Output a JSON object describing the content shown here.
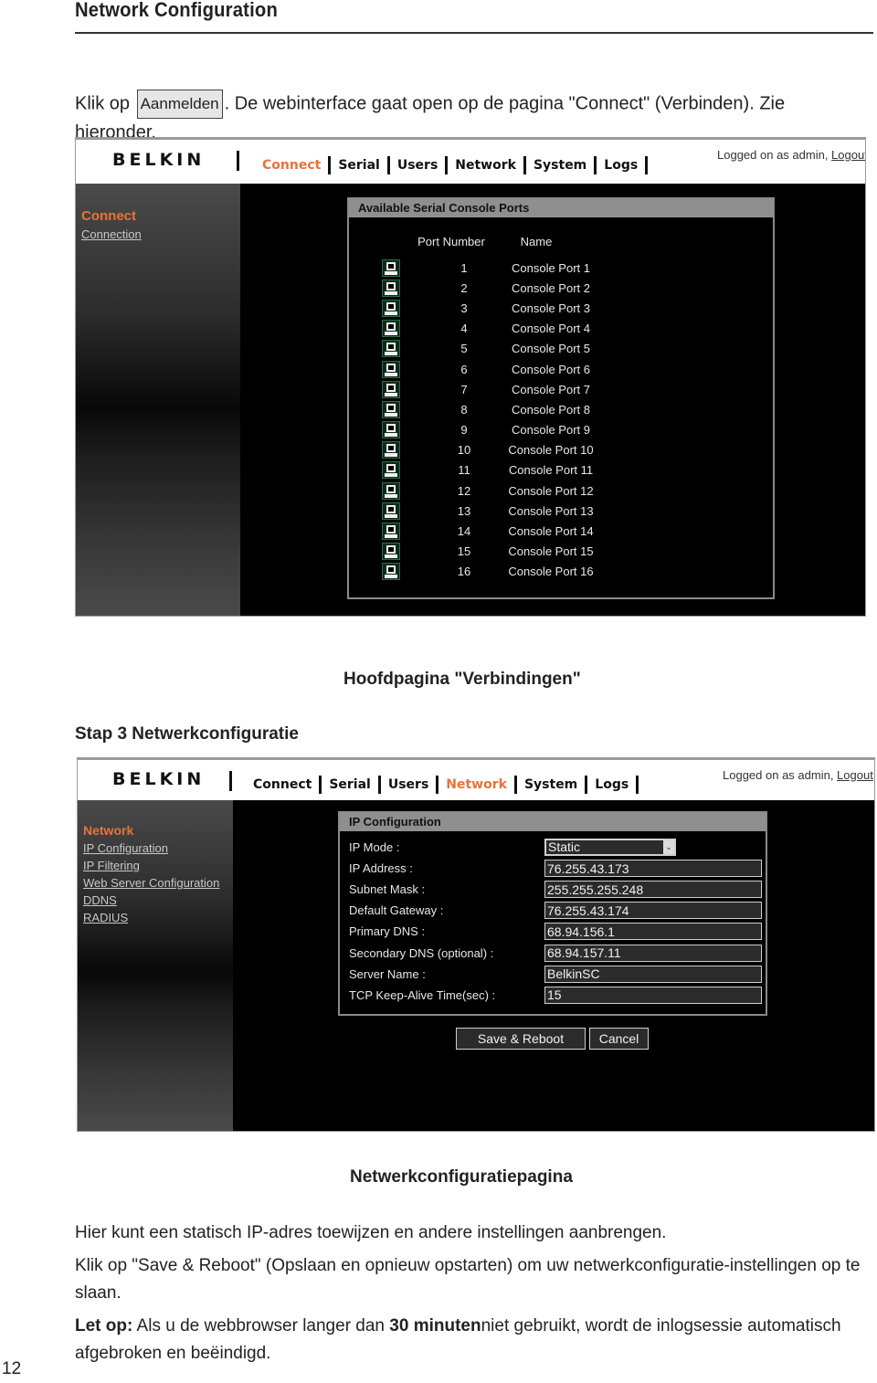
{
  "page": {
    "header": "Network Configuration",
    "page_number": "12",
    "intro_before": "Klik op ",
    "intro_button": "Aanmelden",
    "intro_after": ". De webinterface gaat open op de pagina \"Connect\" (Verbinden). Zie hieronder.",
    "caption1": "Hoofdpagina \"Verbindingen\"",
    "step_heading": "Stap 3 Netwerkconfiguratie",
    "caption2": "Netwerkconfiguratiepagina",
    "body1": "Hier kunt een statisch IP-adres toewijzen en andere instellingen aanbrengen.",
    "body2": "Klik op \"Save & Reboot\" (Opslaan en opnieuw opstarten) om uw netwerkconfiguratie-instellingen op te slaan.",
    "note_label": "Let op:",
    "note_text1": " Als u de webbrowser langer dan ",
    "note_bold": "30 minuten",
    "note_text2": "niet gebruikt, wordt de inlogsessie automatisch afgebroken en beëindigd."
  },
  "app": {
    "brand": "BELKIN",
    "accent_color": "#e8733a",
    "nav": [
      "Connect",
      "Serial",
      "Users",
      "Network",
      "System",
      "Logs"
    ],
    "logged_text": "Logged on as admin, ",
    "logout": "Logout"
  },
  "connect_page": {
    "active_nav": "Connect",
    "sidebar_title": "Connect",
    "sidebar_links": [
      "Connection"
    ],
    "panel_title": "Available Serial Console Ports",
    "col_port": "Port Number",
    "col_name": "Name",
    "port_icon": "computer-terminal-icon",
    "ports": [
      {
        "num": "1",
        "name": "Console Port 1"
      },
      {
        "num": "2",
        "name": "Console Port 2"
      },
      {
        "num": "3",
        "name": "Console Port 3"
      },
      {
        "num": "4",
        "name": "Console Port 4"
      },
      {
        "num": "5",
        "name": "Console Port 5"
      },
      {
        "num": "6",
        "name": "Console Port 6"
      },
      {
        "num": "7",
        "name": "Console Port 7"
      },
      {
        "num": "8",
        "name": "Console Port 8"
      },
      {
        "num": "9",
        "name": "Console Port 9"
      },
      {
        "num": "10",
        "name": "Console Port 10"
      },
      {
        "num": "11",
        "name": "Console Port 11"
      },
      {
        "num": "12",
        "name": "Console Port 12"
      },
      {
        "num": "13",
        "name": "Console Port 13"
      },
      {
        "num": "14",
        "name": "Console Port 14"
      },
      {
        "num": "15",
        "name": "Console Port 15"
      },
      {
        "num": "16",
        "name": "Console Port 16"
      }
    ]
  },
  "network_page": {
    "active_nav": "Network",
    "sidebar_title": "Network",
    "sidebar_links": [
      "IP Configuration",
      "IP Filtering",
      "Web Server Configuration",
      "DDNS",
      "RADIUS"
    ],
    "panel_title": "IP Configuration",
    "ip_mode_label": "IP Mode :",
    "ip_mode_value": "Static",
    "fields": [
      {
        "label": "IP Address :",
        "value": "76.255.43.173"
      },
      {
        "label": "Subnet Mask :",
        "value": "255.255.255.248"
      },
      {
        "label": "Default Gateway :",
        "value": "76.255.43.174"
      },
      {
        "label": "Primary DNS :",
        "value": "68.94.156.1"
      },
      {
        "label": "Secondary DNS (optional) :",
        "value": "68.94.157.11"
      },
      {
        "label": "Server Name :",
        "value": "BelkinSC"
      },
      {
        "label": "TCP Keep-Alive Time(sec) :",
        "value": "15"
      }
    ],
    "save_label": "Save & Reboot",
    "cancel_label": "Cancel"
  }
}
